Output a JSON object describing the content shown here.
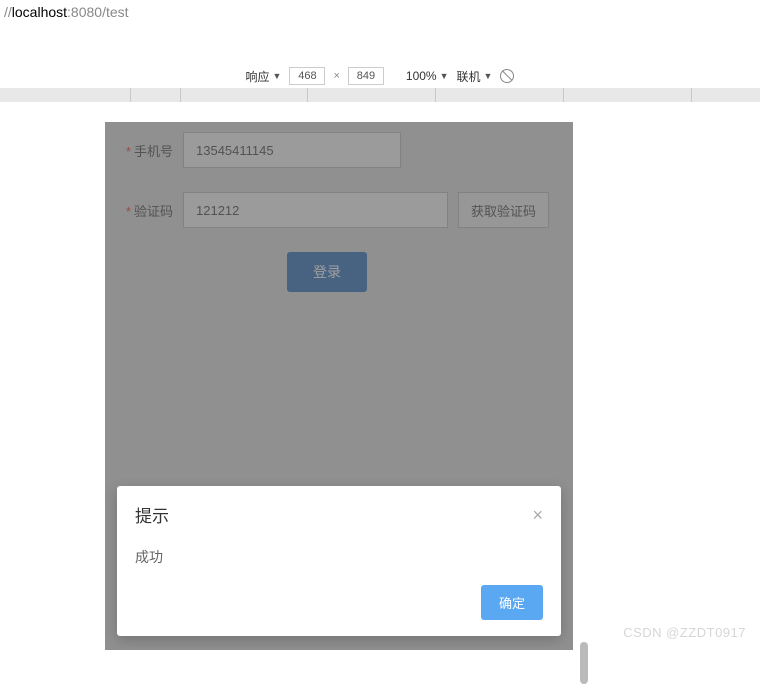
{
  "url": {
    "prefix": "//",
    "host": "localhost",
    "port_path": ":8080/test"
  },
  "dev_toolbar": {
    "responsive_label": "响应",
    "width": "468",
    "height": "849",
    "zoom": "100%",
    "network_label": "联机"
  },
  "form": {
    "phone_label": "手机号",
    "phone_value": "13545411145",
    "code_label": "验证码",
    "code_value": "121212",
    "get_code_label": "获取验证码",
    "login_label": "登录"
  },
  "dialog": {
    "title": "提示",
    "message": "成功",
    "ok_label": "确定"
  },
  "watermark": "CSDN @ZZDT0917"
}
